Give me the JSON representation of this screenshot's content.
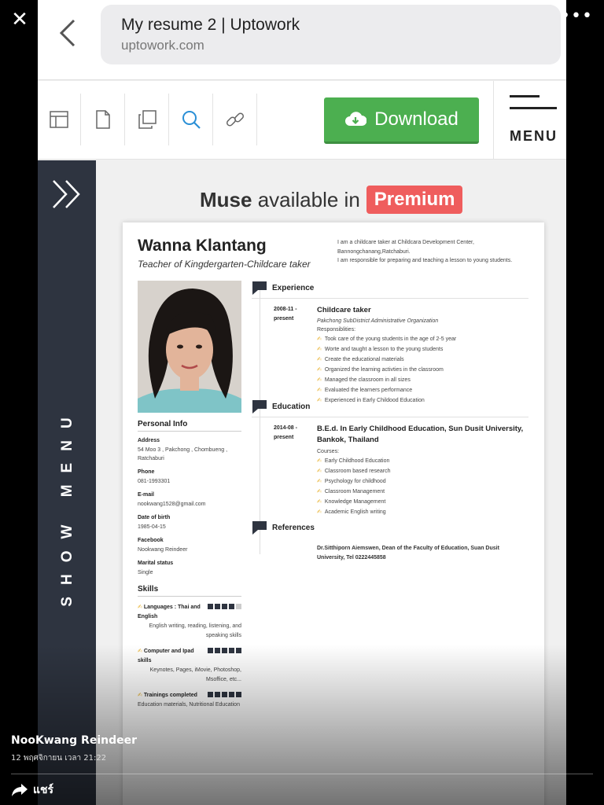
{
  "viewer": {
    "close_glyph": "✕",
    "more_glyph": "•••"
  },
  "browser": {
    "title": "My resume 2 | Uptowork",
    "host": "uptowork.com"
  },
  "toolbar": {
    "tools": [
      "layout-icon",
      "page-icon",
      "copy-icon",
      "search-icon",
      "link-icon"
    ],
    "download_label": "Download",
    "menu_label": "MENU"
  },
  "side_menu": {
    "label": "SHOW MENU"
  },
  "premium": {
    "brand": "Muse",
    "text": " available in",
    "badge": "Premium"
  },
  "resume": {
    "name": "Wanna Klantang",
    "title": "Teacher of Kingdergarten-Childcare taker",
    "summary": [
      "I am a childcare taker at Childcara Development Center,",
      "Bannongchanang,Ratchaburi.",
      "I am responsible for preparing and teaching a lesson to young students."
    ],
    "personal_info": {
      "heading": "Personal Info",
      "fields": [
        {
          "label": "Address",
          "value": "54 Moo 3 , Pakchong , Chombueng , Ratchaburi"
        },
        {
          "label": "Phone",
          "value": "081-1993301"
        },
        {
          "label": "E-mail",
          "value": "nookwang1528@gmail.com"
        },
        {
          "label": "Date of birth",
          "value": "1985-04-15"
        },
        {
          "label": "Facebook",
          "value": "Nookwang Reindeer"
        },
        {
          "label": "Marital status",
          "value": "Single"
        }
      ]
    },
    "skills": {
      "heading": "Skills",
      "items": [
        {
          "name": "Languages : Thai and English",
          "desc": "English writing, reading, listening, and speaking skills",
          "level": 4,
          "max": 5
        },
        {
          "name": "Computer and Ipad skills",
          "desc": "Keynotes, Pages, iMovie, Photoshop, Msoffice, etc...",
          "level": 5,
          "max": 5
        },
        {
          "name": "Trainings completed",
          "desc": "Education materials, Nutritional Education",
          "level": 5,
          "max": 5
        }
      ]
    },
    "experience": {
      "heading": "Experience",
      "date": [
        "2008-11 -",
        "present"
      ],
      "title": "Childcare taker",
      "org": "Pakchong SubDistrict Administrative Organization",
      "sub": "Responsiblities:",
      "items": [
        "Took care of the young students in the age of 2-5 year",
        "Worte and taught a lesson to the young students",
        "Create the educational materials",
        "Organized the learning activties in the classroom",
        "Managed the classroom in all sizes",
        "Evaluated the learners performance",
        "Experienced in Early Childood Education"
      ]
    },
    "education": {
      "heading": "Education",
      "date": [
        "2014-08 -",
        "present"
      ],
      "title": "B.E.d. In Early Childhood Education, Sun Dusit  University, Bankok, Thailand",
      "sub": "Courses:",
      "items": [
        "Early Childhood Education",
        "Classroom based research",
        "Psychology for childhood",
        "Classroom Management",
        "Knowledge Management",
        "Academic English writing"
      ]
    },
    "references": {
      "heading": "References",
      "text": "Dr.Sitthiporn Aiemswen, Dean of the Faculty of Education, Suan Dusit University, Tel 0222445858"
    }
  },
  "caption": {
    "author": "NooKwang Reindeer",
    "time": "12 พฤศจิกายน เวลา 21:22",
    "share_label": "แชร์"
  },
  "colors": {
    "download": "#4caf50",
    "premium": "#ef5d5d",
    "side_menu": "#2e3440",
    "bullet": "#e8b02a"
  }
}
